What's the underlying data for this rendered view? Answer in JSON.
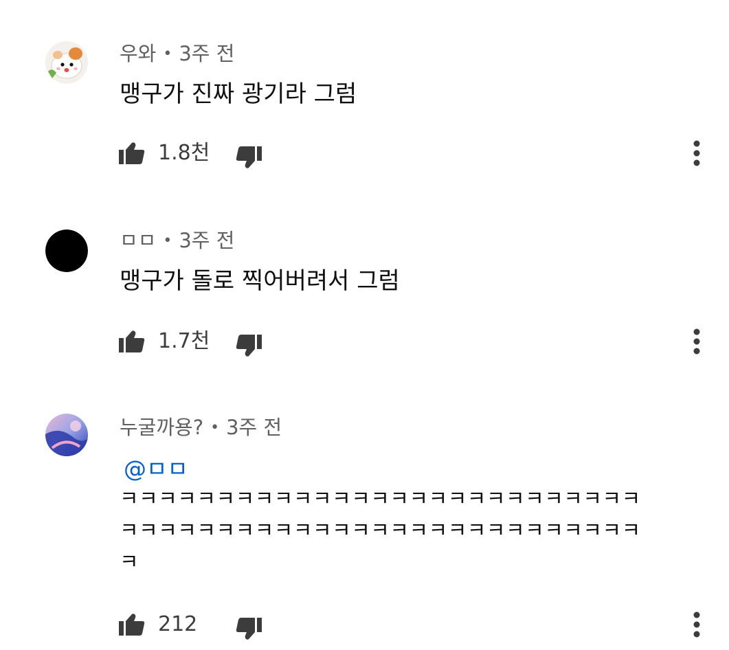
{
  "comments": [
    {
      "author": "우와",
      "separator": "•",
      "time": "3주 전",
      "text_lines": [
        "맹구가 진짜 광기라 그럼"
      ],
      "mention": "",
      "likes": "1.8천",
      "avatar_icon": "hamster-avatar-icon"
    },
    {
      "author": "ㅁㅁ",
      "separator": "•",
      "time": "3주 전",
      "text_lines": [
        "맹구가 돌로 찍어버려서 그럼"
      ],
      "mention": "",
      "likes": "1.7천",
      "avatar_icon": "black-circle-avatar-icon"
    },
    {
      "author": "누굴까용?",
      "separator": "•",
      "time": "3주 전",
      "mention": "@ㅁㅁ",
      "text_lines": [
        "ㅋㅋㅋㅋㅋㅋㅋㅋㅋㅋㅋㅋㅋㅋㅋㅋㅋㅋㅋㅋㅋㅋㅋㅋㅋㅋㅋ",
        "ㅋㅋㅋㅋㅋㅋㅋㅋㅋㅋㅋㅋㅋㅋㅋㅋㅋㅋㅋㅋㅋㅋㅋㅋㅋㅋㅋ",
        "ㅋ"
      ],
      "likes": "212",
      "avatar_icon": "abstract-gradient-avatar-icon"
    }
  ],
  "icons": {
    "like": "thumbs-up-icon",
    "dislike": "thumbs-down-icon",
    "more": "vertical-dots-icon"
  },
  "colors": {
    "text": "#0f0f0f",
    "meta": "#606060",
    "mention": "#065fd4",
    "icon": "#3c3c3c"
  }
}
